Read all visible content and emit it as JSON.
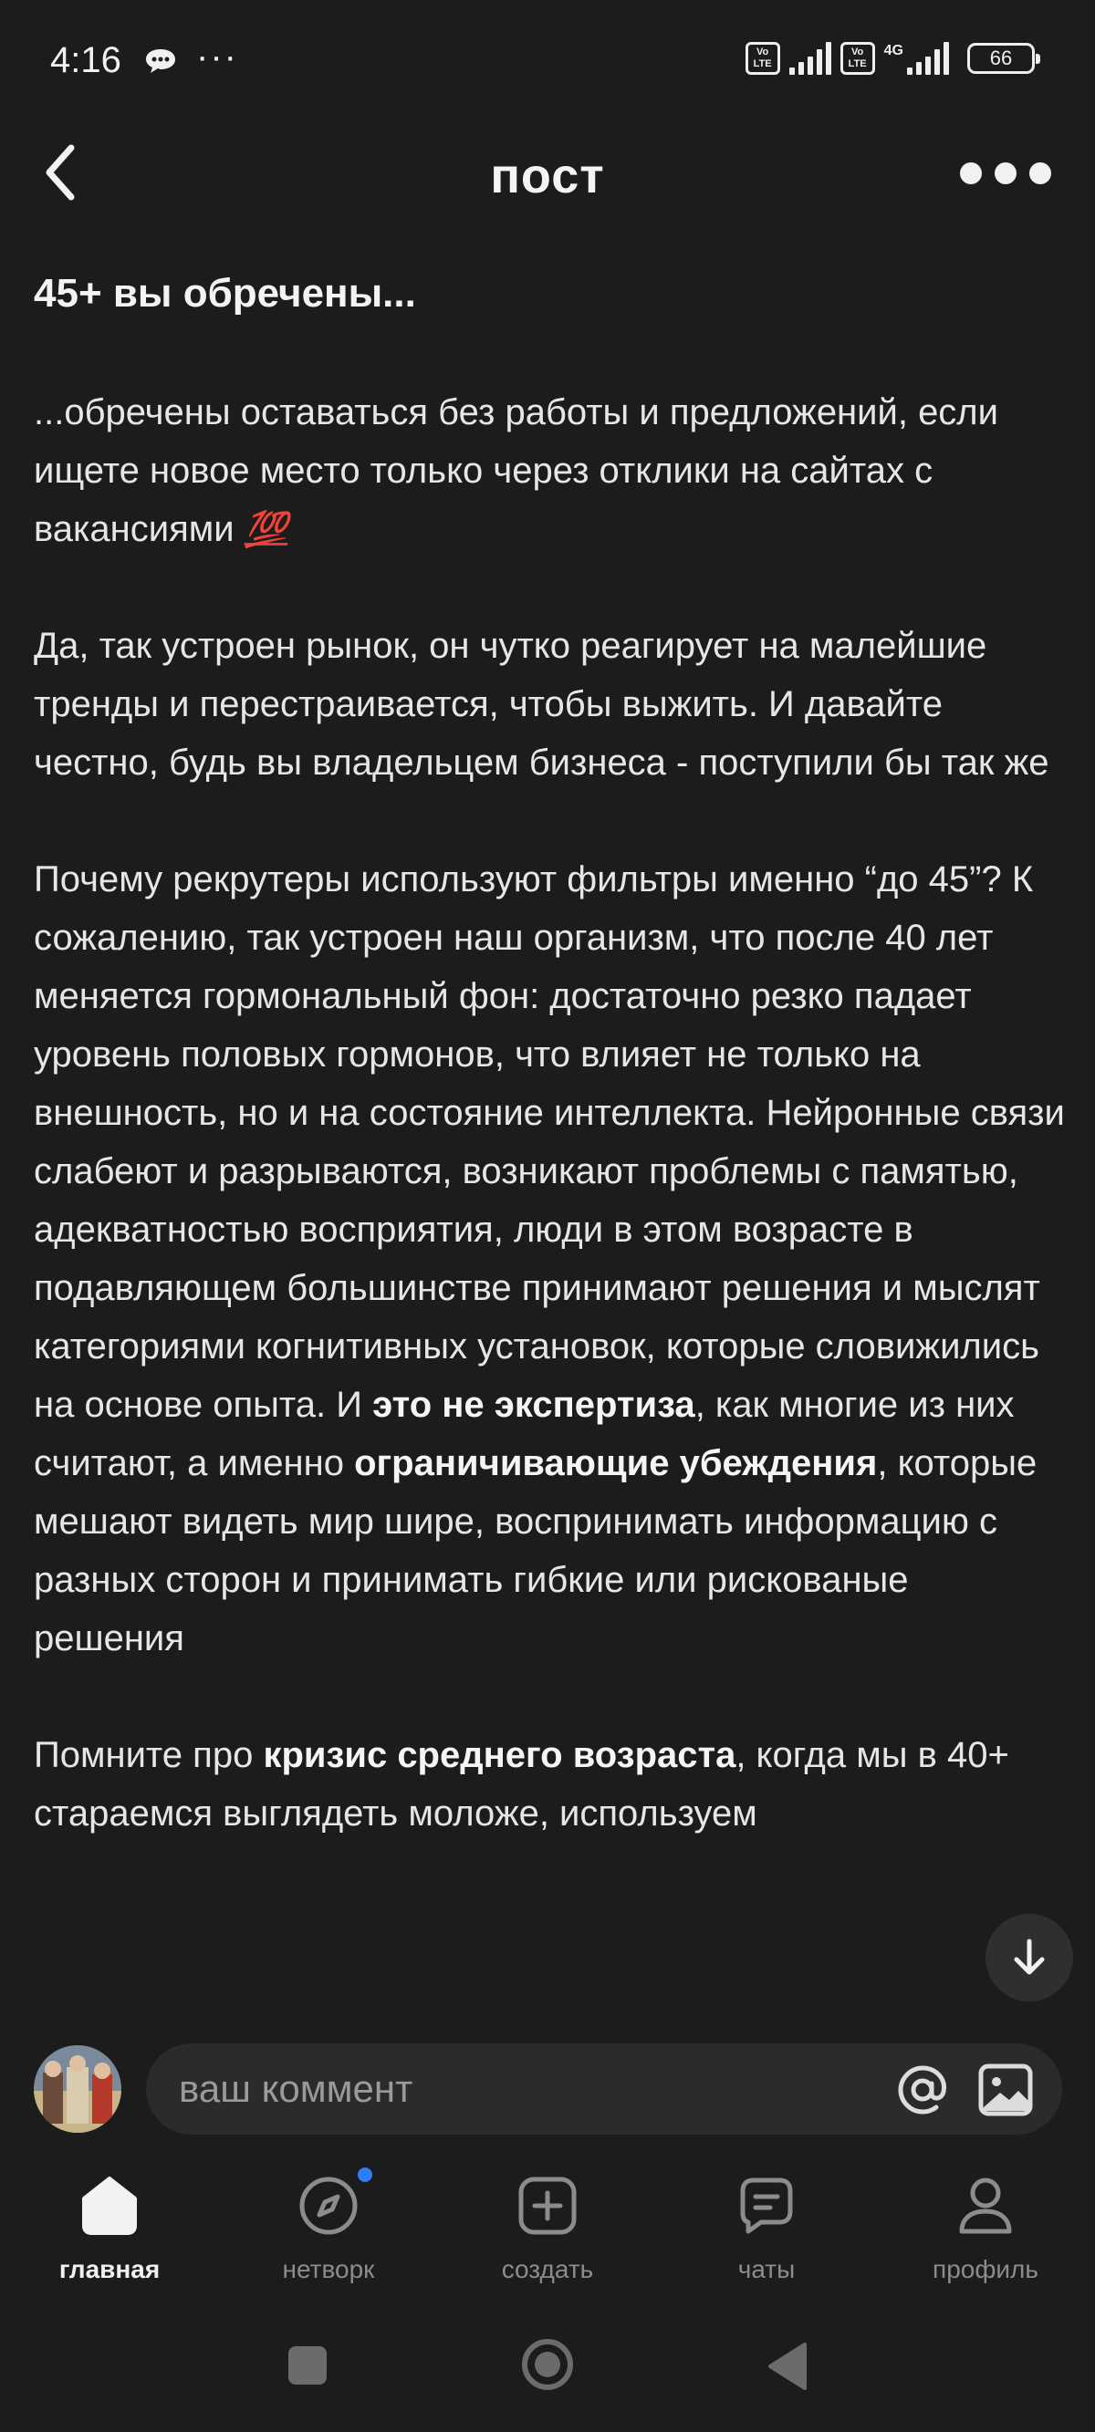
{
  "status_bar": {
    "time": "4:16",
    "network": "4G",
    "battery": "66",
    "volte": "Vo LTE"
  },
  "header": {
    "title": "пост"
  },
  "post": {
    "title": "45+ вы обречены...",
    "p1_text": "...обречены оставаться без работы и предложений, если ищете новое место только через отклики на сайтах с вакансиями",
    "p1_emoji": "💯",
    "p2": "Да, так устроен рынок, он чутко реагирует на малейшие тренды и перестраивается, чтобы выжить. И давайте честно, будь вы владельцем бизнеса - поступили бы так же",
    "p3_part1": "Почему рекрутеры используют фильтры именно “до 45”? К сожалению, так устроен наш организм, что после 40 лет меняется гормональный фон: достаточно резко падает уровень половых гормонов, что влияет не только на внешность, но и на состояние интеллекта. Нейронные связи слабеют и разрываются, возникают проблемы с памятью, адекватностью восприятия, люди в этом возрасте в подавляющем большинстве принимают решения и мыслят категориями когнитивных установок, которые словижились на основе опыта. И ",
    "p3_bold1": "это не экспертиза",
    "p3_part2": ", как многие из них считают, а именно ",
    "p3_bold2": "ограничивающие убеждения",
    "p3_part3": ", которые мешают видеть мир шире, воспринимать информацию с разных сторон и принимать гибкие или рискованые решения",
    "p4_part1": "Помните про ",
    "p4_bold": "кризис среднего возраста",
    "p4_part2": ", когда мы в 40+ стараемся выглядеть моложе, используем"
  },
  "comment": {
    "placeholder": "ваш коммент"
  },
  "nav": [
    {
      "label": "главная",
      "icon": "home-icon",
      "active": true
    },
    {
      "label": "нетворк",
      "icon": "compass-icon",
      "active": false,
      "badge": true
    },
    {
      "label": "создать",
      "icon": "plus-square-icon",
      "active": false
    },
    {
      "label": "чаты",
      "icon": "chat-icon",
      "active": false
    },
    {
      "label": "профиль",
      "icon": "person-icon",
      "active": false
    }
  ],
  "colors": {
    "background": "#1c1c1c",
    "input_background": "#2b2b2b",
    "accent_dot": "#2d7cf6",
    "inactive_label": "#8c8c8c"
  }
}
